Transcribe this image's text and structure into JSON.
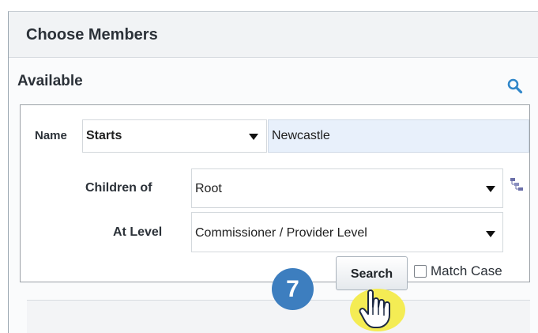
{
  "dialog": {
    "title": "Choose Members",
    "section_label": "Available"
  },
  "filter": {
    "name_label": "Name",
    "operator": "Starts",
    "value": "Newcastle",
    "children_of_label": "Children of",
    "children_of_value": "Root",
    "at_level_label": "At Level",
    "at_level_value": "Commissioner / Provider Level",
    "search_button": "Search",
    "match_case_label": "Match Case",
    "match_case_checked": false
  },
  "annotation": {
    "step_number": "7"
  },
  "colors": {
    "accent": "#3d7ebf",
    "cursor_highlight": "#f4ec54",
    "input_fill": "#e8f0fb"
  },
  "icons": [
    "search-icon",
    "hierarchy-icon",
    "dropdown-arrow-icon",
    "hand-cursor-icon"
  ]
}
